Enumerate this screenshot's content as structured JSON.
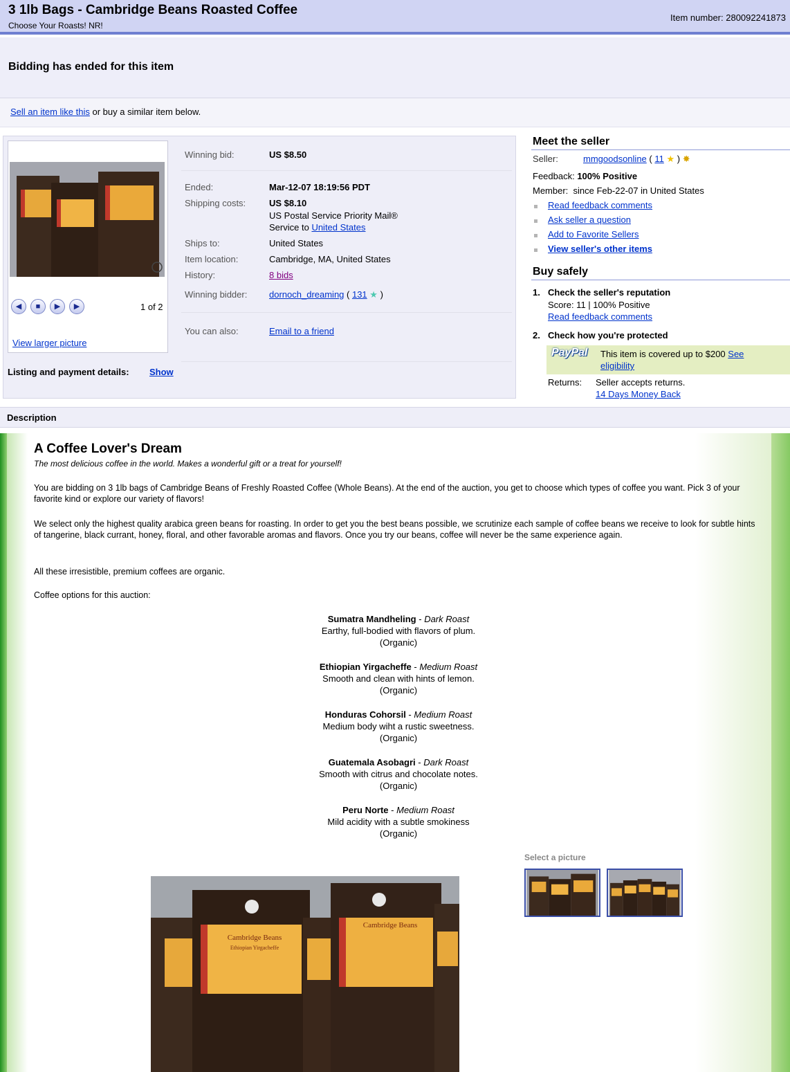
{
  "header": {
    "title": "3 1lb Bags - Cambridge Beans Roasted Coffee",
    "subtitle": "Choose Your Roasts! NR!",
    "item_number": "Item number: 280092241873"
  },
  "status": {
    "ended": "Bidding has ended for this item",
    "sell_link": "Sell an item like this",
    "sell_rest": " or buy a similar item below."
  },
  "gallery": {
    "count": "1 of 2",
    "view_larger": "View larger picture"
  },
  "listing": {
    "label": "Listing and payment details:",
    "show": "Show"
  },
  "details": {
    "winning_bid_label": "Winning bid:",
    "winning_bid": "US $8.50",
    "ended_label": "Ended:",
    "ended": "Mar-12-07 18:19:56 PDT",
    "shipping_label": "Shipping costs:",
    "shipping": "US $8.10",
    "shipping_service": "US Postal Service Priority Mail®",
    "service_to": "Service to",
    "service_to_link": "United States",
    "ships_to_label": "Ships to:",
    "ships_to": "United States",
    "location_label": "Item location:",
    "location": "Cambridge, MA, United States",
    "history_label": "History:",
    "history": "8 bids",
    "winner_label": "Winning bidder:",
    "winner": "dornoch_dreaming",
    "winner_score": "131",
    "also_label": "You can also:",
    "email_friend": "Email to a friend"
  },
  "seller": {
    "heading": "Meet the seller",
    "seller_label": "Seller:",
    "seller_name": "mmgoodsonline",
    "seller_score": "11",
    "feedback_label": "Feedback:",
    "feedback": "100% Positive",
    "member_label": "Member:",
    "member": "since Feb-22-07 in United States",
    "links": [
      "Read feedback comments",
      "Ask seller a question",
      "Add to Favorite Sellers",
      "View seller's other items"
    ]
  },
  "buysafe": {
    "heading": "Buy safely",
    "step1_num": "1.",
    "step1": "Check the seller's reputation",
    "score": "Score: 11 | 100% Positive",
    "read_feedback": "Read feedback comments",
    "step2_num": "2.",
    "step2": "Check how you're protected",
    "paypal_logo": "PayPal",
    "paypal_text": "This item is covered up to $200",
    "see": "See",
    "eligibility": "eligibility",
    "returns_label": "Returns:",
    "returns": "Seller accepts returns.",
    "returns_link": "14 Days Money Back"
  },
  "description": {
    "label": "Description",
    "heading": "A Coffee Lover's Dream",
    "tagline": "The most delicious coffee in the world. Makes a wonderful gift or a treat for yourself!",
    "p1": "You are bidding on 3 1lb bags of Cambridge Beans of Freshly Roasted Coffee (Whole Beans). At the end of the auction, you get to choose which types of coffee you want. Pick 3 of your favorite kind or explore our variety of flavors!",
    "p2": "We select only the highest quality arabica green beans for roasting. In order to get you the best beans possible, we scrutinize each sample of coffee beans we receive to look for subtle hints of tangerine, black currant, honey, floral, and other favorable aromas and flavors. Once you try our beans, coffee will never be the same experience again.",
    "p3": "All these irresistible, premium coffees are organic.",
    "p4": "Coffee options for this auction:",
    "coffees": [
      {
        "name": "Sumatra Mandheling",
        "roast": "Dark Roast",
        "desc": "Earthy, full-bodied with flavors of plum.",
        "org": "(Organic)"
      },
      {
        "name": "Ethiopian Yirgacheffe",
        "roast": "Medium Roast",
        "desc": "Smooth and clean with hints of lemon.",
        "org": "(Organic)"
      },
      {
        "name": "Honduras Cohorsil",
        "roast": "Medium Roast",
        "desc": "Medium body wiht a rustic sweetness.",
        "org": "(Organic)"
      },
      {
        "name": "Guatemala Asobagri",
        "roast": "Dark Roast",
        "desc": "Smooth with citrus and chocolate notes.",
        "org": "(Organic)"
      },
      {
        "name": "Peru Norte",
        "roast": "Medium Roast",
        "desc": "Mild acidity with a subtle smokiness",
        "org": "(Organic)"
      }
    ],
    "select_picture": "Select a picture"
  },
  "product_label": {
    "brand": "Cambridge Beans",
    "variety": "Ethiopian Yirgacheffe"
  },
  "colors": {
    "title_bar": "#d0d4f3",
    "link": "#0033cc",
    "visited": "#800080",
    "paypal_box": "#e4eec2"
  }
}
